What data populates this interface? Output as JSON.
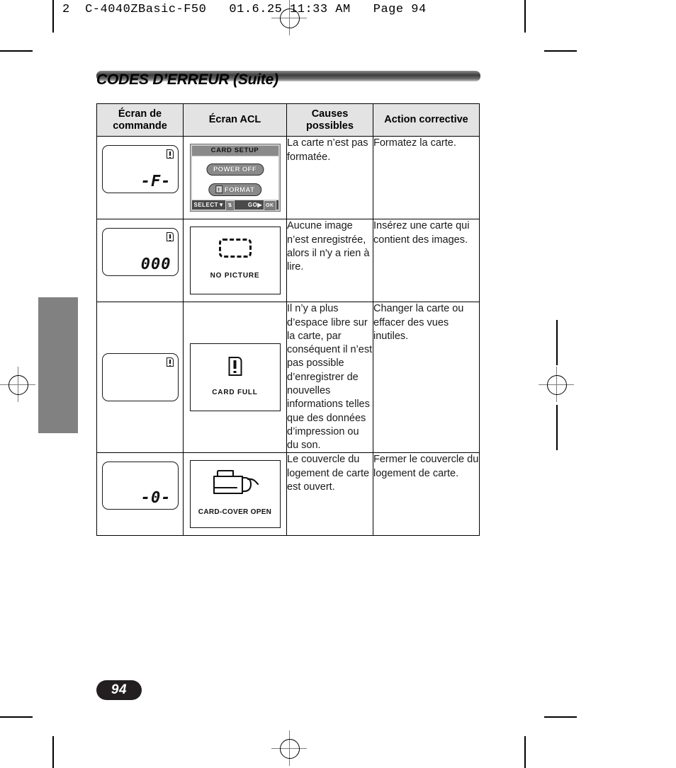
{
  "running_header": "2  C-4040ZBasic-F50   01.6.25 11:33 AM   Page 94",
  "section": {
    "title": "CODES D’ERREUR (Suite)"
  },
  "page_number": "94",
  "table": {
    "headers": [
      "Écran de commande",
      "Écran ACL",
      "Causes possibles",
      "Action corrective"
    ],
    "rows": [
      {
        "control_panel": {
          "segment_value": "-F-",
          "card_icon": true
        },
        "lcd_screen": {
          "kind": "card-setup-menu",
          "menu_title": "CARD SETUP",
          "options": [
            "POWER OFF",
            "FORMAT"
          ],
          "format_badge": "↑",
          "footer_left": "SELECT",
          "footer_right": "GO",
          "footer_ok": "OK"
        },
        "cause": "La carte n’est pas formatée.",
        "action": "Formatez la carte."
      },
      {
        "control_panel": {
          "segment_value": "000",
          "card_icon": true
        },
        "lcd_screen": {
          "kind": "no-picture",
          "message": "NO  PICTURE"
        },
        "cause": "Aucune image n’est enregistrée, alors il n'y a rien à lire.",
        "action": "Insérez une carte qui contient des images."
      },
      {
        "control_panel": {
          "segment_value": "",
          "card_icon": true
        },
        "lcd_screen": {
          "kind": "card-full",
          "message": "CARD  FULL"
        },
        "cause": "Il n’y a plus d’espace libre sur la carte, par conséquent il n’est pas possible d’enregistrer de nouvelles informations telles que des données d’impression ou du son.",
        "action": "Changer la carte ou effacer des vues inutiles."
      },
      {
        "control_panel": {
          "segment_value": "-0-",
          "card_icon": false
        },
        "lcd_screen": {
          "kind": "card-cover-open",
          "message": "CARD-COVER OPEN"
        },
        "cause": "Le couvercle du logement de carte est ouvert.",
        "action": "Fermer le couvercle du logement de carte."
      }
    ]
  }
}
